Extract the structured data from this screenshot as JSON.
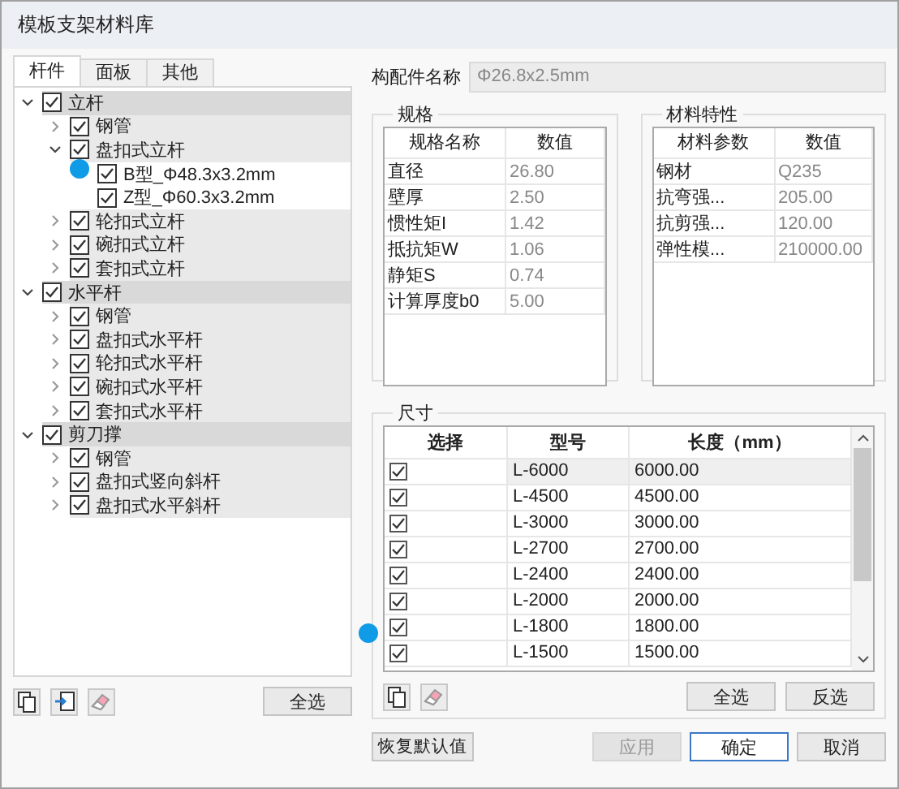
{
  "window": {
    "title": "模板支架材料库"
  },
  "tabs": [
    {
      "label": "杆件",
      "selected": true
    },
    {
      "label": "面板",
      "selected": false
    },
    {
      "label": "其他",
      "selected": false
    }
  ],
  "tree": [
    {
      "label": "立杆",
      "checked": true,
      "expanded": true,
      "children": [
        {
          "label": "钢管",
          "checked": true,
          "expanded": false
        },
        {
          "label": "盘扣式立杆",
          "checked": true,
          "expanded": true,
          "children": [
            {
              "label": "B型_Φ48.3x3.2mm",
              "checked": true
            },
            {
              "label": "Z型_Φ60.3x3.2mm",
              "checked": true
            }
          ]
        },
        {
          "label": "轮扣式立杆",
          "checked": true,
          "expanded": false
        },
        {
          "label": "碗扣式立杆",
          "checked": true,
          "expanded": false
        },
        {
          "label": "套扣式立杆",
          "checked": true,
          "expanded": false
        }
      ]
    },
    {
      "label": "水平杆",
      "checked": true,
      "expanded": true,
      "children": [
        {
          "label": "钢管",
          "checked": true,
          "expanded": false
        },
        {
          "label": "盘扣式水平杆",
          "checked": true,
          "expanded": false
        },
        {
          "label": "轮扣式水平杆",
          "checked": true,
          "expanded": false
        },
        {
          "label": "碗扣式水平杆",
          "checked": true,
          "expanded": false
        },
        {
          "label": "套扣式水平杆",
          "checked": true,
          "expanded": false
        }
      ]
    },
    {
      "label": "剪刀撑",
      "checked": true,
      "expanded": true,
      "children": [
        {
          "label": "钢管",
          "checked": true,
          "expanded": false
        },
        {
          "label": "盘扣式竖向斜杆",
          "checked": true,
          "expanded": false
        },
        {
          "label": "盘扣式水平斜杆",
          "checked": true,
          "expanded": false
        }
      ]
    }
  ],
  "left_buttons": {
    "select_all": "全选"
  },
  "component_name": {
    "label": "构配件名称",
    "value": "Φ26.8x2.5mm"
  },
  "spec": {
    "title": "规格",
    "columns": [
      "规格名称",
      "数值"
    ],
    "rows": [
      [
        "直径",
        "26.80"
      ],
      [
        "壁厚",
        "2.50"
      ],
      [
        "惯性矩I",
        "1.42"
      ],
      [
        "抵抗矩W",
        "1.06"
      ],
      [
        "静矩S",
        "0.74"
      ],
      [
        "计算厚度b0",
        "5.00"
      ]
    ]
  },
  "material": {
    "title": "材料特性",
    "columns": [
      "材料参数",
      "数值"
    ],
    "rows": [
      [
        "钢材",
        "Q235"
      ],
      [
        "抗弯强...",
        "205.00"
      ],
      [
        "抗剪强...",
        "120.00"
      ],
      [
        "弹性模...",
        "210000.00"
      ]
    ]
  },
  "dimensions": {
    "title": "尺寸",
    "columns": [
      "选择",
      "型号",
      "长度（mm）"
    ],
    "rows": [
      {
        "checked": true,
        "model": "L-6000",
        "length": "6000.00",
        "selected": true
      },
      {
        "checked": true,
        "model": "L-4500",
        "length": "4500.00",
        "selected": false
      },
      {
        "checked": true,
        "model": "L-3000",
        "length": "3000.00",
        "selected": false
      },
      {
        "checked": true,
        "model": "L-2700",
        "length": "2700.00",
        "selected": false
      },
      {
        "checked": true,
        "model": "L-2400",
        "length": "2400.00",
        "selected": false
      },
      {
        "checked": true,
        "model": "L-2000",
        "length": "2000.00",
        "selected": false
      },
      {
        "checked": true,
        "model": "L-1800",
        "length": "1800.00",
        "selected": false
      },
      {
        "checked": true,
        "model": "L-1500",
        "length": "1500.00",
        "selected": false
      }
    ],
    "buttons": [
      "全选",
      "反选"
    ]
  },
  "footer": {
    "restore": "恢复默认值",
    "buttons": [
      {
        "label": "应用",
        "disabled": true,
        "default": false
      },
      {
        "label": "确定",
        "disabled": false,
        "default": true
      },
      {
        "label": "取消",
        "disabled": false,
        "default": false
      }
    ]
  }
}
